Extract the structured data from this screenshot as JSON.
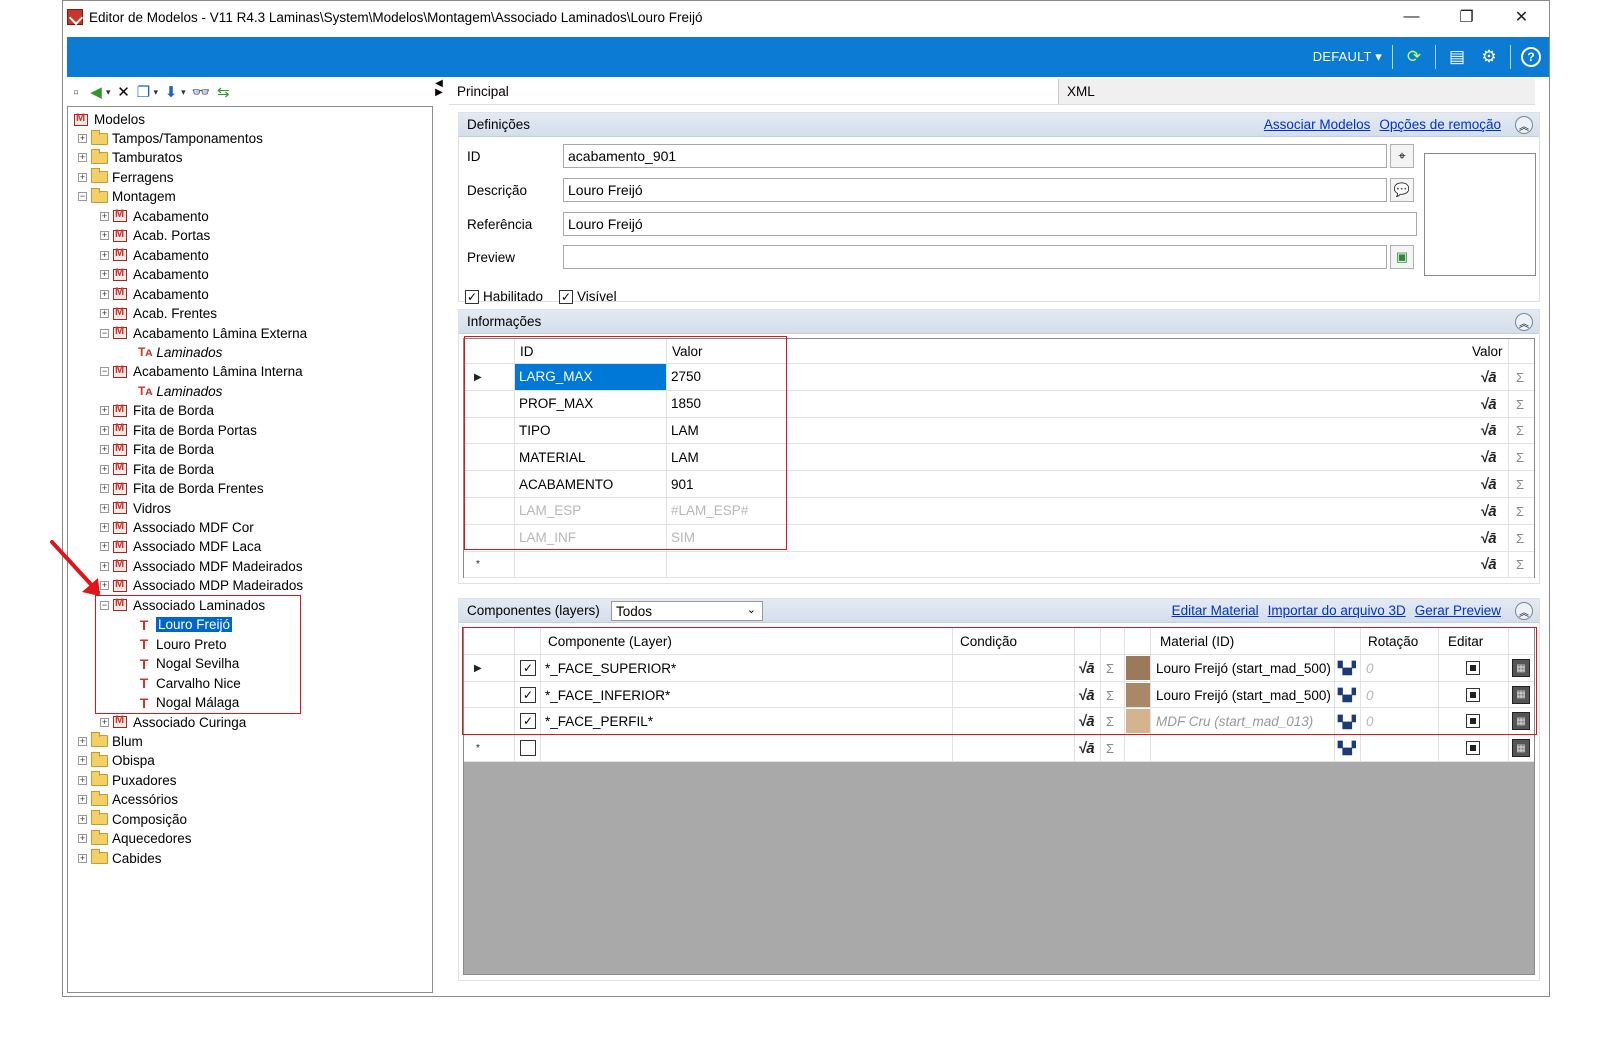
{
  "window": {
    "title": "Editor de Modelos - V11 R4.3 Laminas\\System\\Modelos\\Montagem\\Associado Laminados\\Louro Freijó",
    "minimize": "—",
    "maximize": "❐",
    "close": "✕"
  },
  "topbar": {
    "profile": "DEFAULT ▾"
  },
  "tree": {
    "root": "Modelos",
    "items": [
      {
        "label": "Tampos/Tamponamentos",
        "type": "folder",
        "level": 1,
        "exp": "+"
      },
      {
        "label": "Tamburatos",
        "type": "folder",
        "level": 1,
        "exp": "+"
      },
      {
        "label": "Ferragens",
        "type": "folder",
        "level": 1,
        "exp": "+"
      },
      {
        "label": "Montagem",
        "type": "folder",
        "level": 1,
        "exp": "−"
      },
      {
        "label": "Acabamento",
        "type": "model",
        "level": 2,
        "exp": "+"
      },
      {
        "label": "Acab. Portas",
        "type": "model",
        "level": 2,
        "exp": "+"
      },
      {
        "label": "Acabamento",
        "type": "model",
        "level": 2,
        "exp": "+"
      },
      {
        "label": "Acabamento",
        "type": "model",
        "level": 2,
        "exp": "+"
      },
      {
        "label": "Acabamento",
        "type": "model",
        "level": 2,
        "exp": "+"
      },
      {
        "label": "Acab. Frentes",
        "type": "model",
        "level": 2,
        "exp": "+"
      },
      {
        "label": "Acabamento Lâmina Externa",
        "type": "model",
        "level": 2,
        "exp": "−"
      },
      {
        "label": "Laminados",
        "type": "ta",
        "level": 3,
        "italic": true
      },
      {
        "label": "Acabamento Lâmina Interna",
        "type": "model",
        "level": 2,
        "exp": "−"
      },
      {
        "label": "Laminados",
        "type": "ta",
        "level": 3,
        "italic": true
      },
      {
        "label": "Fita de Borda",
        "type": "model",
        "level": 2,
        "exp": "+"
      },
      {
        "label": "Fita de Borda Portas",
        "type": "model",
        "level": 2,
        "exp": "+"
      },
      {
        "label": "Fita de Borda",
        "type": "model",
        "level": 2,
        "exp": "+"
      },
      {
        "label": "Fita de Borda",
        "type": "model",
        "level": 2,
        "exp": "+"
      },
      {
        "label": "Fita de Borda Frentes",
        "type": "model",
        "level": 2,
        "exp": "+"
      },
      {
        "label": "Vidros",
        "type": "model",
        "level": 2,
        "exp": "+"
      },
      {
        "label": "Associado MDF Cor",
        "type": "model",
        "level": 2,
        "exp": "+"
      },
      {
        "label": "Associado MDF Laca",
        "type": "model",
        "level": 2,
        "exp": "+"
      },
      {
        "label": "Associado MDF Madeirados",
        "type": "model",
        "level": 2,
        "exp": "+"
      },
      {
        "label": "Associado MDP Madeirados",
        "type": "model",
        "level": 2,
        "exp": "+"
      },
      {
        "label": "Associado Laminados",
        "type": "model",
        "level": 2,
        "exp": "−"
      },
      {
        "label": "Louro Freijó",
        "type": "t",
        "level": 3,
        "selected": true
      },
      {
        "label": "Louro Preto",
        "type": "t",
        "level": 3
      },
      {
        "label": "Nogal Sevilha",
        "type": "t",
        "level": 3
      },
      {
        "label": "Carvalho Nice",
        "type": "t",
        "level": 3
      },
      {
        "label": "Nogal Málaga",
        "type": "t",
        "level": 3
      },
      {
        "label": "Associado Curinga",
        "type": "model",
        "level": 2,
        "exp": "+"
      },
      {
        "label": "Blum",
        "type": "folder",
        "level": 1,
        "exp": "+"
      },
      {
        "label": "Obispa",
        "type": "folder",
        "level": 1,
        "exp": "+"
      },
      {
        "label": "Puxadores",
        "type": "folder",
        "level": 1,
        "exp": "+"
      },
      {
        "label": "Acessórios",
        "type": "folder",
        "level": 1,
        "exp": "+"
      },
      {
        "label": "Composição",
        "type": "folder",
        "level": 1,
        "exp": "+"
      },
      {
        "label": "Aquecedores",
        "type": "folder",
        "level": 1,
        "exp": "+"
      },
      {
        "label": "Cabides",
        "type": "folder",
        "level": 1,
        "exp": "+"
      }
    ]
  },
  "tabs": {
    "principal": "Principal",
    "xml": "XML"
  },
  "definicoes": {
    "title": "Definições",
    "link_associar": "Associar Modelos",
    "link_opcoes": "Opções de remoção",
    "id_label": "ID",
    "id_value": "acabamento_901",
    "descricao_label": "Descrição",
    "descricao_value": "Louro Freijó",
    "referencia_label": "Referência",
    "referencia_value": "Louro Freijó",
    "preview_label": "Preview",
    "preview_value": "",
    "habilitado": "Habilitado",
    "visivel": "Visível"
  },
  "informacoes": {
    "title": "Informações",
    "col_id": "ID",
    "col_valor": "Valor",
    "col_valor_right": "Valor",
    "rows": [
      {
        "id": "LARG_MAX",
        "valor": "2750",
        "dim": false
      },
      {
        "id": "PROF_MAX",
        "valor": "1850",
        "dim": false
      },
      {
        "id": "TIPO",
        "valor": "LAM",
        "dim": false
      },
      {
        "id": "MATERIAL",
        "valor": "LAM",
        "dim": false
      },
      {
        "id": "ACABAMENTO",
        "valor": "901",
        "dim": false
      },
      {
        "id": "LAM_ESP",
        "valor": "#LAM_ESP#",
        "dim": true
      },
      {
        "id": "LAM_INF",
        "valor": "SIM",
        "dim": true
      }
    ],
    "new_row_marker": "*"
  },
  "componentes": {
    "title": "Componentes (layers)",
    "filter": "Todos",
    "link_editar": "Editar Material",
    "link_importar": "Importar do arquivo 3D",
    "link_gerar": "Gerar Preview",
    "col_componente": "Componente (Layer)",
    "col_condicao": "Condição",
    "col_material": "Material (ID)",
    "col_rotacao": "Rotação",
    "col_editar": "Editar",
    "rows": [
      {
        "componente": "*_FACE_SUPERIOR*",
        "material": "Louro Freijó (start_mad_500)",
        "rotacao": "0",
        "italic": false,
        "wood": "#9b7a5c"
      },
      {
        "componente": "*_FACE_INFERIOR*",
        "material": "Louro Freijó (start_mad_500)",
        "rotacao": "0",
        "italic": false,
        "wood": "#a88866"
      },
      {
        "componente": "*_FACE_PERFIL*",
        "material": "MDF Cru (start_mad_013)",
        "rotacao": "0",
        "italic": true,
        "wood": "#d4b48e"
      }
    ],
    "new_row_marker": "*"
  },
  "colors": {
    "accent": "#0b7bd4",
    "selection": "#0078d7",
    "highlight_red": "#e0141b",
    "grid_empty": "#a9a9a9"
  }
}
